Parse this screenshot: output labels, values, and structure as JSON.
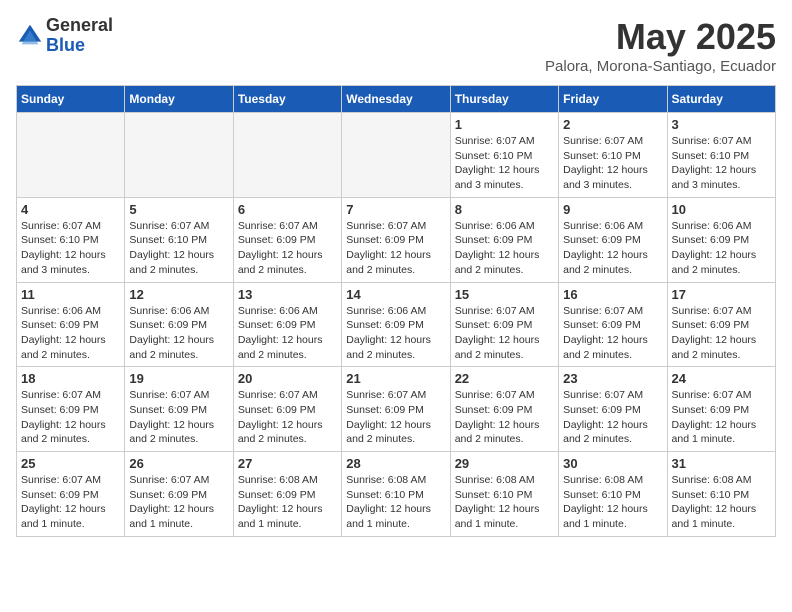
{
  "header": {
    "logo_general": "General",
    "logo_blue": "Blue",
    "title": "May 2025",
    "location": "Palora, Morona-Santiago, Ecuador"
  },
  "weekdays": [
    "Sunday",
    "Monday",
    "Tuesday",
    "Wednesday",
    "Thursday",
    "Friday",
    "Saturday"
  ],
  "weeks": [
    [
      {
        "day": "",
        "info": ""
      },
      {
        "day": "",
        "info": ""
      },
      {
        "day": "",
        "info": ""
      },
      {
        "day": "",
        "info": ""
      },
      {
        "day": "1",
        "info": "Sunrise: 6:07 AM\nSunset: 6:10 PM\nDaylight: 12 hours\nand 3 minutes."
      },
      {
        "day": "2",
        "info": "Sunrise: 6:07 AM\nSunset: 6:10 PM\nDaylight: 12 hours\nand 3 minutes."
      },
      {
        "day": "3",
        "info": "Sunrise: 6:07 AM\nSunset: 6:10 PM\nDaylight: 12 hours\nand 3 minutes."
      }
    ],
    [
      {
        "day": "4",
        "info": "Sunrise: 6:07 AM\nSunset: 6:10 PM\nDaylight: 12 hours\nand 3 minutes."
      },
      {
        "day": "5",
        "info": "Sunrise: 6:07 AM\nSunset: 6:10 PM\nDaylight: 12 hours\nand 2 minutes."
      },
      {
        "day": "6",
        "info": "Sunrise: 6:07 AM\nSunset: 6:09 PM\nDaylight: 12 hours\nand 2 minutes."
      },
      {
        "day": "7",
        "info": "Sunrise: 6:07 AM\nSunset: 6:09 PM\nDaylight: 12 hours\nand 2 minutes."
      },
      {
        "day": "8",
        "info": "Sunrise: 6:06 AM\nSunset: 6:09 PM\nDaylight: 12 hours\nand 2 minutes."
      },
      {
        "day": "9",
        "info": "Sunrise: 6:06 AM\nSunset: 6:09 PM\nDaylight: 12 hours\nand 2 minutes."
      },
      {
        "day": "10",
        "info": "Sunrise: 6:06 AM\nSunset: 6:09 PM\nDaylight: 12 hours\nand 2 minutes."
      }
    ],
    [
      {
        "day": "11",
        "info": "Sunrise: 6:06 AM\nSunset: 6:09 PM\nDaylight: 12 hours\nand 2 minutes."
      },
      {
        "day": "12",
        "info": "Sunrise: 6:06 AM\nSunset: 6:09 PM\nDaylight: 12 hours\nand 2 minutes."
      },
      {
        "day": "13",
        "info": "Sunrise: 6:06 AM\nSunset: 6:09 PM\nDaylight: 12 hours\nand 2 minutes."
      },
      {
        "day": "14",
        "info": "Sunrise: 6:06 AM\nSunset: 6:09 PM\nDaylight: 12 hours\nand 2 minutes."
      },
      {
        "day": "15",
        "info": "Sunrise: 6:07 AM\nSunset: 6:09 PM\nDaylight: 12 hours\nand 2 minutes."
      },
      {
        "day": "16",
        "info": "Sunrise: 6:07 AM\nSunset: 6:09 PM\nDaylight: 12 hours\nand 2 minutes."
      },
      {
        "day": "17",
        "info": "Sunrise: 6:07 AM\nSunset: 6:09 PM\nDaylight: 12 hours\nand 2 minutes."
      }
    ],
    [
      {
        "day": "18",
        "info": "Sunrise: 6:07 AM\nSunset: 6:09 PM\nDaylight: 12 hours\nand 2 minutes."
      },
      {
        "day": "19",
        "info": "Sunrise: 6:07 AM\nSunset: 6:09 PM\nDaylight: 12 hours\nand 2 minutes."
      },
      {
        "day": "20",
        "info": "Sunrise: 6:07 AM\nSunset: 6:09 PM\nDaylight: 12 hours\nand 2 minutes."
      },
      {
        "day": "21",
        "info": "Sunrise: 6:07 AM\nSunset: 6:09 PM\nDaylight: 12 hours\nand 2 minutes."
      },
      {
        "day": "22",
        "info": "Sunrise: 6:07 AM\nSunset: 6:09 PM\nDaylight: 12 hours\nand 2 minutes."
      },
      {
        "day": "23",
        "info": "Sunrise: 6:07 AM\nSunset: 6:09 PM\nDaylight: 12 hours\nand 2 minutes."
      },
      {
        "day": "24",
        "info": "Sunrise: 6:07 AM\nSunset: 6:09 PM\nDaylight: 12 hours\nand 1 minute."
      }
    ],
    [
      {
        "day": "25",
        "info": "Sunrise: 6:07 AM\nSunset: 6:09 PM\nDaylight: 12 hours\nand 1 minute."
      },
      {
        "day": "26",
        "info": "Sunrise: 6:07 AM\nSunset: 6:09 PM\nDaylight: 12 hours\nand 1 minute."
      },
      {
        "day": "27",
        "info": "Sunrise: 6:08 AM\nSunset: 6:09 PM\nDaylight: 12 hours\nand 1 minute."
      },
      {
        "day": "28",
        "info": "Sunrise: 6:08 AM\nSunset: 6:10 PM\nDaylight: 12 hours\nand 1 minute."
      },
      {
        "day": "29",
        "info": "Sunrise: 6:08 AM\nSunset: 6:10 PM\nDaylight: 12 hours\nand 1 minute."
      },
      {
        "day": "30",
        "info": "Sunrise: 6:08 AM\nSunset: 6:10 PM\nDaylight: 12 hours\nand 1 minute."
      },
      {
        "day": "31",
        "info": "Sunrise: 6:08 AM\nSunset: 6:10 PM\nDaylight: 12 hours\nand 1 minute."
      }
    ]
  ]
}
